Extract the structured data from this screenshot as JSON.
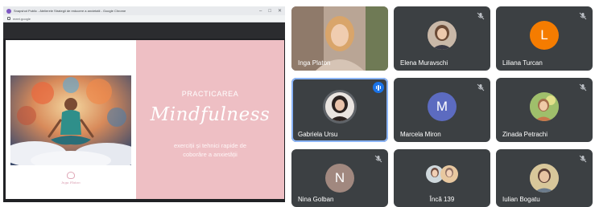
{
  "window": {
    "title": "Snapshot Public - Atelierele Strategii de reducere a anxietatii - Google Chrome",
    "url": "meet.google",
    "controls": [
      "–",
      "□",
      "✕"
    ]
  },
  "slide": {
    "kicker": "PRACTICAREA",
    "title": "Mindfulness",
    "subtitle_line1": "exerciții și tehnici rapide de",
    "subtitle_line2": "coborâre a anxietății",
    "logo_text": "Inga Platon"
  },
  "participants": [
    {
      "name": "Inga Platon",
      "type": "video",
      "muted": false
    },
    {
      "name": "Elena Muravschi",
      "type": "photo",
      "muted": true
    },
    {
      "name": "Liliana Turcan",
      "type": "initial",
      "initial": "L",
      "color": "#f57c00",
      "muted": true
    },
    {
      "name": "Gabriela Ursu",
      "type": "photo",
      "muted": false,
      "speaking": true
    },
    {
      "name": "Marcela Miron",
      "type": "initial",
      "initial": "M",
      "color": "#5c6bc0",
      "muted": true
    },
    {
      "name": "Zinada Petrachi",
      "type": "photo",
      "muted": true
    },
    {
      "name": "Nina Golban",
      "type": "initial",
      "initial": "N",
      "color": "#a1887f",
      "muted": true
    },
    {
      "name": "Încă 139",
      "type": "group",
      "muted": false
    },
    {
      "name": "Iulian Bogatu",
      "type": "photo",
      "muted": true
    }
  ],
  "colors": {
    "tile_bg": "#3c4043",
    "slide_pink": "#eebfc4",
    "speaking_accent": "#1a73e8"
  },
  "icons": {
    "mic_off": "mic-off-icon",
    "speaking": "audio-level-icon"
  }
}
